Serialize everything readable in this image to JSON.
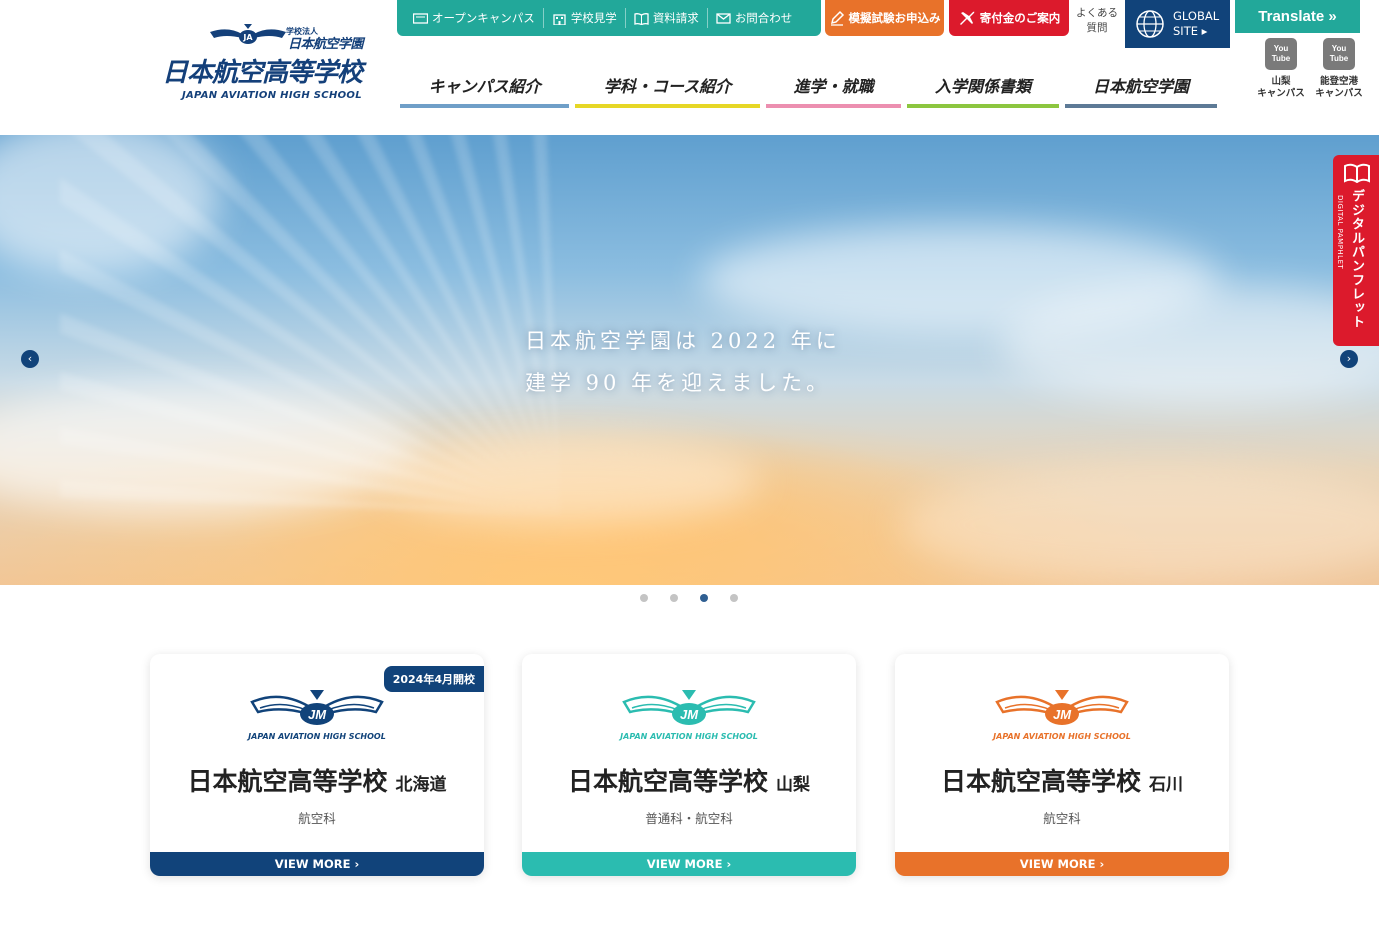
{
  "logo": {
    "corp_label": "学校法人",
    "corp_name": "日本航空学園",
    "school_name": "日本航空高等学校",
    "english_name": "JAPAN AVIATION HIGH SCHOOL"
  },
  "utility": {
    "items": [
      {
        "label": "オープンキャンパス",
        "icon": "ticket-icon"
      },
      {
        "label": "学校見学",
        "icon": "building-icon"
      },
      {
        "label": "資料請求",
        "icon": "book-icon"
      },
      {
        "label": "お問合わせ",
        "icon": "mail-icon"
      }
    ],
    "exam_label": "模擬試験お申込み",
    "donate_label": "寄付金のご案内",
    "faq_line1": "よくある",
    "faq_line2": "質問",
    "global_line1": "GLOBAL",
    "global_line2": "SITE ▸",
    "translate_label": "Translate »"
  },
  "youtube": [
    {
      "icon_text": "You Tube",
      "line1": "山梨",
      "line2": "キャンパス"
    },
    {
      "icon_text": "You Tube",
      "line1": "能登空港",
      "line2": "キャンパス"
    }
  ],
  "nav": [
    {
      "label": "キャンパス紹介",
      "color": "#6f9fc8"
    },
    {
      "label": "学科・コース紹介",
      "color": "#e6d726"
    },
    {
      "label": "進学・就職",
      "color": "#ec8fb0"
    },
    {
      "label": "入学関係書類",
      "color": "#8cc63f"
    },
    {
      "label": "日本航空学園",
      "color": "#5d7a96"
    }
  ],
  "hero": {
    "caption_line1": "日本航空学園は 2022 年に",
    "caption_line2": "建学 90 年を迎えました。",
    "prev": "‹",
    "next": "›",
    "slide_count": 4,
    "active_slide": 3
  },
  "pamphlet": {
    "jp": "デジタルパンフレット",
    "en": "DIGITAL PAMPHLET"
  },
  "cards": [
    {
      "badge": "2024年4月開校",
      "emblem_en": "JAPAN AVIATION HIGH SCHOOL",
      "name": "日本航空高等学校",
      "region": "北海道",
      "dept": "航空科",
      "more": "VIEW MORE ›",
      "color": "#11437a"
    },
    {
      "badge": "",
      "emblem_en": "JAPAN AVIATION HIGH SCHOOL",
      "name": "日本航空高等学校",
      "region": "山梨",
      "dept": "普通科・航空科",
      "more": "VIEW MORE ›",
      "color": "#2bbcb0"
    },
    {
      "badge": "",
      "emblem_en": "JAPAN AVIATION HIGH SCHOOL",
      "name": "日本航空高等学校",
      "region": "石川",
      "dept": "航空科",
      "more": "VIEW MORE ›",
      "color": "#e8722a"
    }
  ]
}
